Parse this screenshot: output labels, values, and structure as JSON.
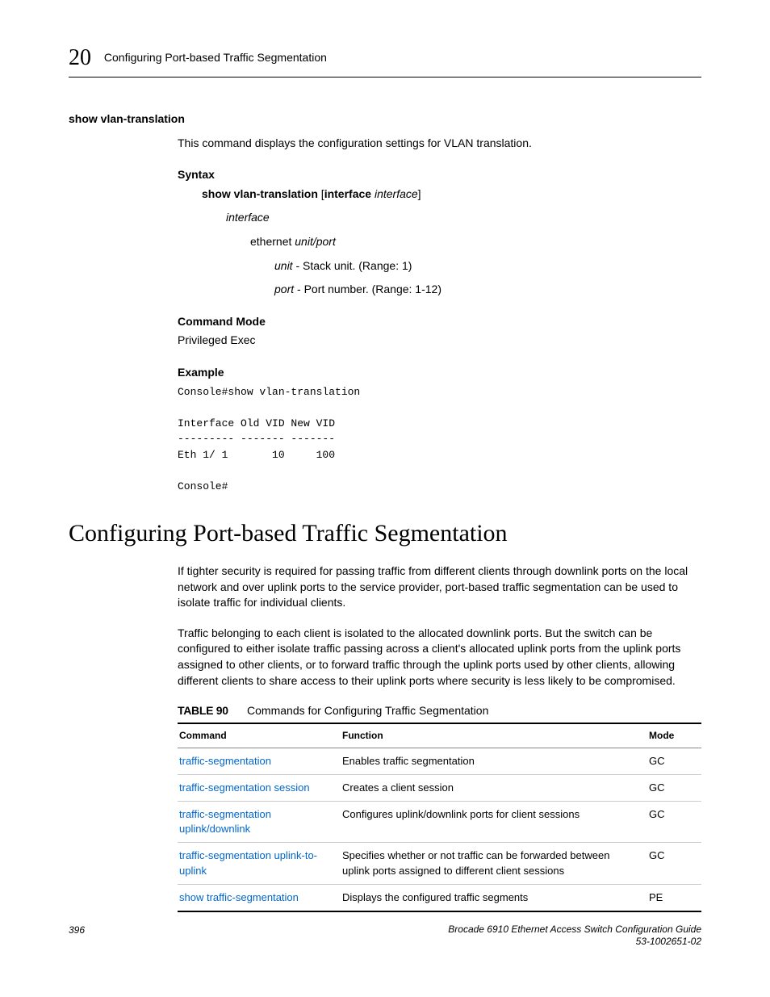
{
  "header": {
    "chapter_num": "20",
    "chapter_title": "Configuring Port-based Traffic Segmentation"
  },
  "section1": {
    "heading": "show vlan-translation",
    "desc": "This command displays the configuration settings for VLAN translation.",
    "syntax_label": "Syntax",
    "syntax_cmd_kw1": "show vlan-translation",
    "syntax_cmd_br_open": " [",
    "syntax_cmd_kw2": "interface",
    "syntax_cmd_sp": " ",
    "syntax_cmd_it": "interface",
    "syntax_cmd_br_close": "]",
    "interface_it": "interface",
    "ethernet_kw": "ethernet",
    "ethernet_it": " unit/port",
    "unit_it": "unit",
    "unit_desc": " - Stack unit. (Range: 1)",
    "port_it": "port",
    "port_desc": " - Port number. (Range: 1-12)",
    "cmdmode_label": "Command Mode",
    "cmdmode_value": "Privileged Exec",
    "example_label": "Example",
    "console": "Console#show vlan-translation\n\nInterface Old VID New VID\n--------- ------- -------\nEth 1/ 1       10     100\n\nConsole#"
  },
  "section2": {
    "heading": "Configuring Port-based Traffic Segmentation",
    "para1": "If tighter security is required for passing traffic from different clients through downlink ports on the local network and over uplink ports to the service provider, port-based traffic segmentation can be used to isolate traffic for individual clients.",
    "para2": "Traffic belonging to each client is isolated to the allocated downlink ports. But the switch can be configured to either isolate traffic passing across a client's allocated uplink ports from the uplink ports assigned to other clients, or to forward traffic through the uplink ports used by other clients, allowing different clients to share access to their uplink ports where security is less likely to be compromised.",
    "table_label": "TABLE 90",
    "table_title": "Commands for Configuring Traffic Segmentation",
    "th_command": "Command",
    "th_function": "Function",
    "th_mode": "Mode",
    "rows": [
      {
        "cmd": "traffic-segmentation",
        "fn": "Enables traffic segmentation",
        "mode": "GC"
      },
      {
        "cmd": "traffic-segmentation session",
        "fn": "Creates a client session",
        "mode": "GC"
      },
      {
        "cmd": "traffic-segmentation uplink/downlink",
        "fn": "Configures uplink/downlink ports for client sessions",
        "mode": "GC"
      },
      {
        "cmd": "traffic-segmentation uplink-to-uplink",
        "fn": "Specifies whether or not traffic can be forwarded between uplink ports assigned to different client sessions",
        "mode": "GC"
      },
      {
        "cmd": "show traffic-segmentation",
        "fn": "Displays the configured traffic segments",
        "mode": "PE"
      }
    ]
  },
  "footer": {
    "page_num": "396",
    "book_title": "Brocade 6910 Ethernet Access Switch Configuration Guide",
    "doc_id": "53-1002651-02"
  }
}
